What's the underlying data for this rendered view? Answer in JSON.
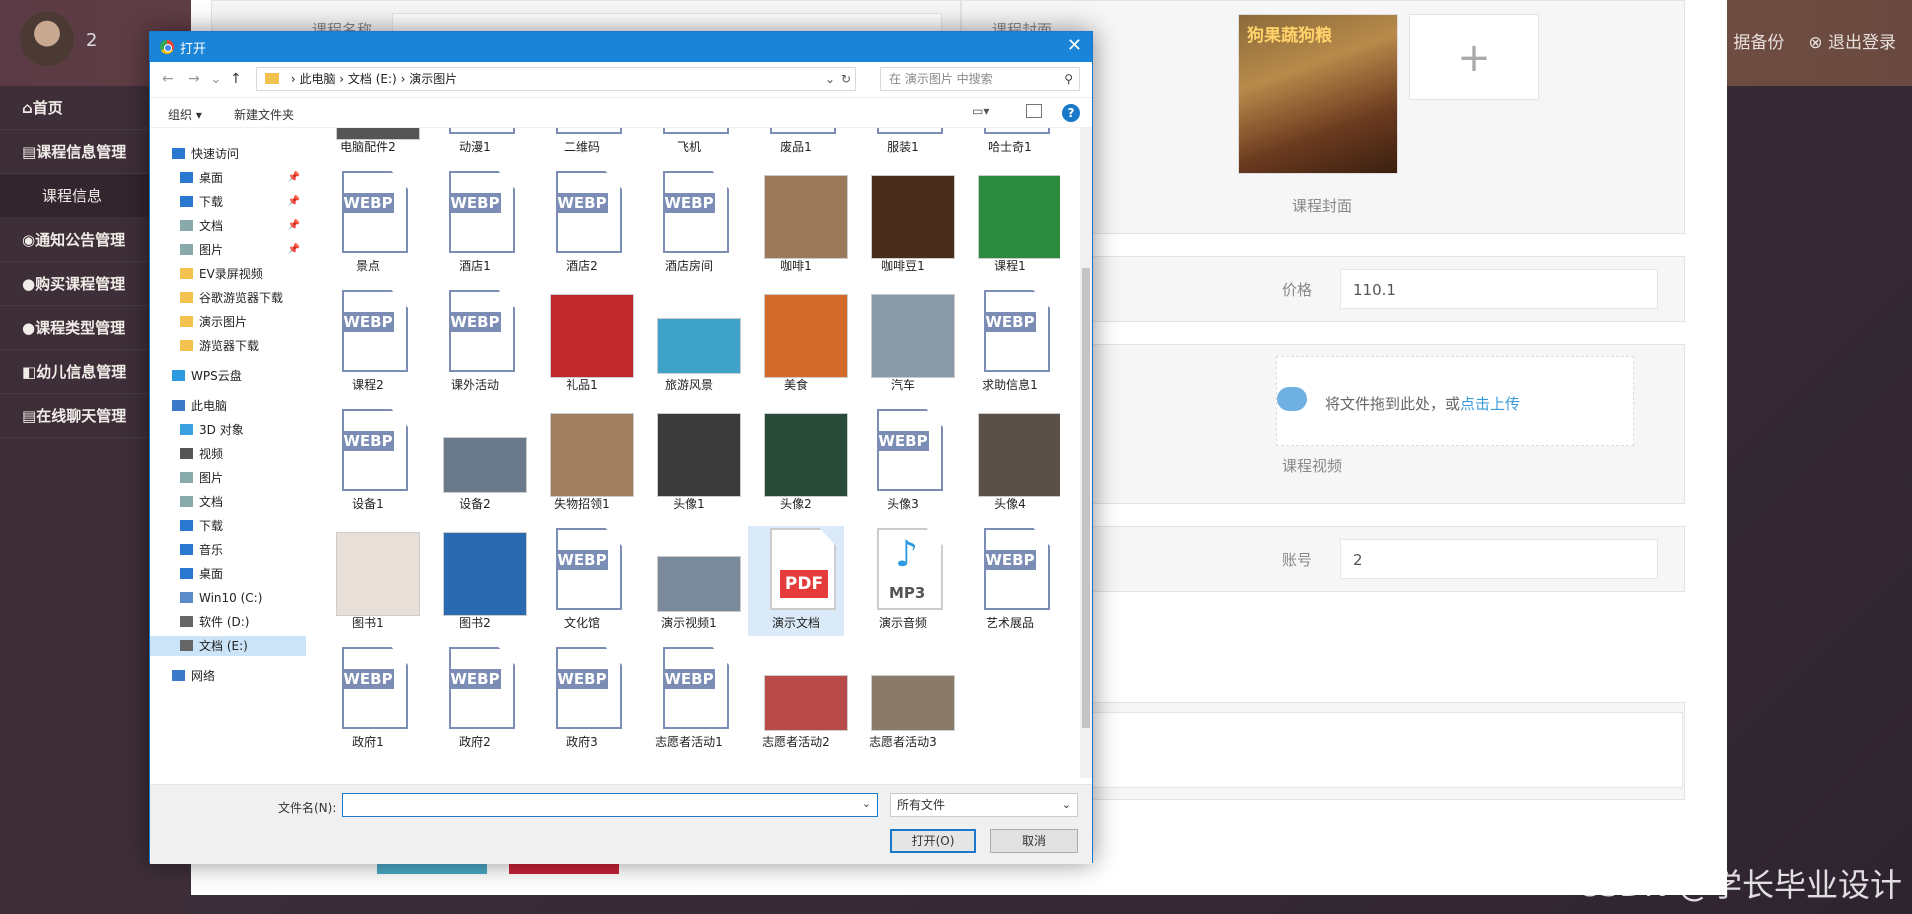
{
  "header": {
    "user_name": "2",
    "backup_label": "据备份",
    "logout_label": "退出登录"
  },
  "sidebar": {
    "items": [
      {
        "label": "首页"
      },
      {
        "label": "课程信息管理"
      },
      {
        "label": "课程信息"
      },
      {
        "label": "通知公告管理"
      },
      {
        "label": "购买课程管理"
      },
      {
        "label": "课程类型管理"
      },
      {
        "label": "幼儿信息管理"
      },
      {
        "label": "在线聊天管理"
      }
    ]
  },
  "form": {
    "course_name_label": "课程名称",
    "cover_label": "课程封面",
    "cover_field_label": "课程封面",
    "cover_image_text": "狗果蔬狗粮",
    "price_label": "价格",
    "price_value": "110.1",
    "upload_text": "将文件拖到此处，或",
    "upload_link": "点击上传",
    "video_label": "课程视频",
    "account_label": "账号",
    "account_value": "2"
  },
  "dialog": {
    "title": "打开",
    "breadcrumb": [
      "此电脑",
      "文档 (E:)",
      "演示图片"
    ],
    "search_placeholder": "在 演示图片 中搜索",
    "organize_label": "组织 ▾",
    "new_folder_label": "新建文件夹",
    "nav": [
      {
        "label": "快速访问",
        "pinned": false
      },
      {
        "label": "桌面",
        "pinned": true
      },
      {
        "label": "下载",
        "pinned": true
      },
      {
        "label": "文档",
        "pinned": true
      },
      {
        "label": "图片",
        "pinned": true
      },
      {
        "label": "EV录屏视频",
        "pinned": false
      },
      {
        "label": "谷歌游览器下载",
        "pinned": false
      },
      {
        "label": "演示图片",
        "pinned": false
      },
      {
        "label": "游览器下载",
        "pinned": false
      },
      {
        "label": "WPS云盘",
        "pinned": false
      },
      {
        "label": "此电脑",
        "pinned": false
      },
      {
        "label": "3D 对象",
        "pinned": false
      },
      {
        "label": "视频",
        "pinned": false
      },
      {
        "label": "图片",
        "pinned": false
      },
      {
        "label": "文档",
        "pinned": false
      },
      {
        "label": "下载",
        "pinned": false
      },
      {
        "label": "音乐",
        "pinned": false
      },
      {
        "label": "桌面",
        "pinned": false
      },
      {
        "label": "Win10 (C:)",
        "pinned": false
      },
      {
        "label": "软件 (D:)",
        "pinned": false
      },
      {
        "label": "文档 (E:)",
        "pinned": false
      },
      {
        "label": "网络",
        "pinned": false
      }
    ],
    "files": [
      {
        "name": "电脑配件2",
        "kind": "photo",
        "color": "#555555"
      },
      {
        "name": "动漫1",
        "kind": "webp"
      },
      {
        "name": "二维码",
        "kind": "webp"
      },
      {
        "name": "飞机",
        "kind": "webp"
      },
      {
        "name": "废品1",
        "kind": "webp"
      },
      {
        "name": "服装1",
        "kind": "webp"
      },
      {
        "name": "哈士奇1",
        "kind": "webp"
      },
      {
        "name": "景点",
        "kind": "webp"
      },
      {
        "name": "酒店1",
        "kind": "webp"
      },
      {
        "name": "酒店2",
        "kind": "webp"
      },
      {
        "name": "酒店房间",
        "kind": "webp"
      },
      {
        "name": "咖啡1",
        "kind": "photo",
        "color": "#9a7a5a"
      },
      {
        "name": "咖啡豆1",
        "kind": "photo",
        "color": "#4a2e1c"
      },
      {
        "name": "课程1",
        "kind": "photo",
        "color": "#2b8a3e"
      },
      {
        "name": "课程2",
        "kind": "webp"
      },
      {
        "name": "课外活动",
        "kind": "webp"
      },
      {
        "name": "礼品1",
        "kind": "photo",
        "color": "#c0282e"
      },
      {
        "name": "旅游风景",
        "kind": "wide",
        "color": "#3fa3c9"
      },
      {
        "name": "美食",
        "kind": "photo",
        "color": "#d46a2a"
      },
      {
        "name": "汽车",
        "kind": "photo",
        "color": "#8a9aa8"
      },
      {
        "name": "求助信息1",
        "kind": "webp"
      },
      {
        "name": "设备1",
        "kind": "webp"
      },
      {
        "name": "设备2",
        "kind": "wide",
        "color": "#6a7a8a"
      },
      {
        "name": "失物招领1",
        "kind": "photo",
        "color": "#a08060"
      },
      {
        "name": "头像1",
        "kind": "photo",
        "color": "#3a3a3a"
      },
      {
        "name": "头像2",
        "kind": "photo",
        "color": "#2a4a3a"
      },
      {
        "name": "头像3",
        "kind": "webp"
      },
      {
        "name": "头像4",
        "kind": "photo",
        "color": "#5a5048"
      },
      {
        "name": "图书1",
        "kind": "photo",
        "color": "#e8e0d8"
      },
      {
        "name": "图书2",
        "kind": "photo",
        "color": "#2a6ab0"
      },
      {
        "name": "文化馆",
        "kind": "webp"
      },
      {
        "name": "演示视频1",
        "kind": "wide",
        "color": "#7a8a9a"
      },
      {
        "name": "演示文档",
        "kind": "pdf"
      },
      {
        "name": "演示音频",
        "kind": "mp3"
      },
      {
        "name": "艺术展品",
        "kind": "webp"
      },
      {
        "name": "政府1",
        "kind": "webp"
      },
      {
        "name": "政府2",
        "kind": "webp"
      },
      {
        "name": "政府3",
        "kind": "webp"
      },
      {
        "name": "志愿者活动1",
        "kind": "webp"
      },
      {
        "name": "志愿者活动2",
        "kind": "wide",
        "color": "#b84a4a"
      },
      {
        "name": "志愿者活动3",
        "kind": "wide",
        "color": "#8a7a6a"
      }
    ],
    "filename_label": "文件名(N):",
    "filename_value": "",
    "filetype_value": "所有文件",
    "open_label": "打开(O)",
    "cancel_label": "取消"
  },
  "watermark": "CSDN @学长毕业设计",
  "icons": {
    "webp_tag": "WEBP",
    "pdf_tag": "PDF",
    "mp3_tag": "MP3"
  }
}
